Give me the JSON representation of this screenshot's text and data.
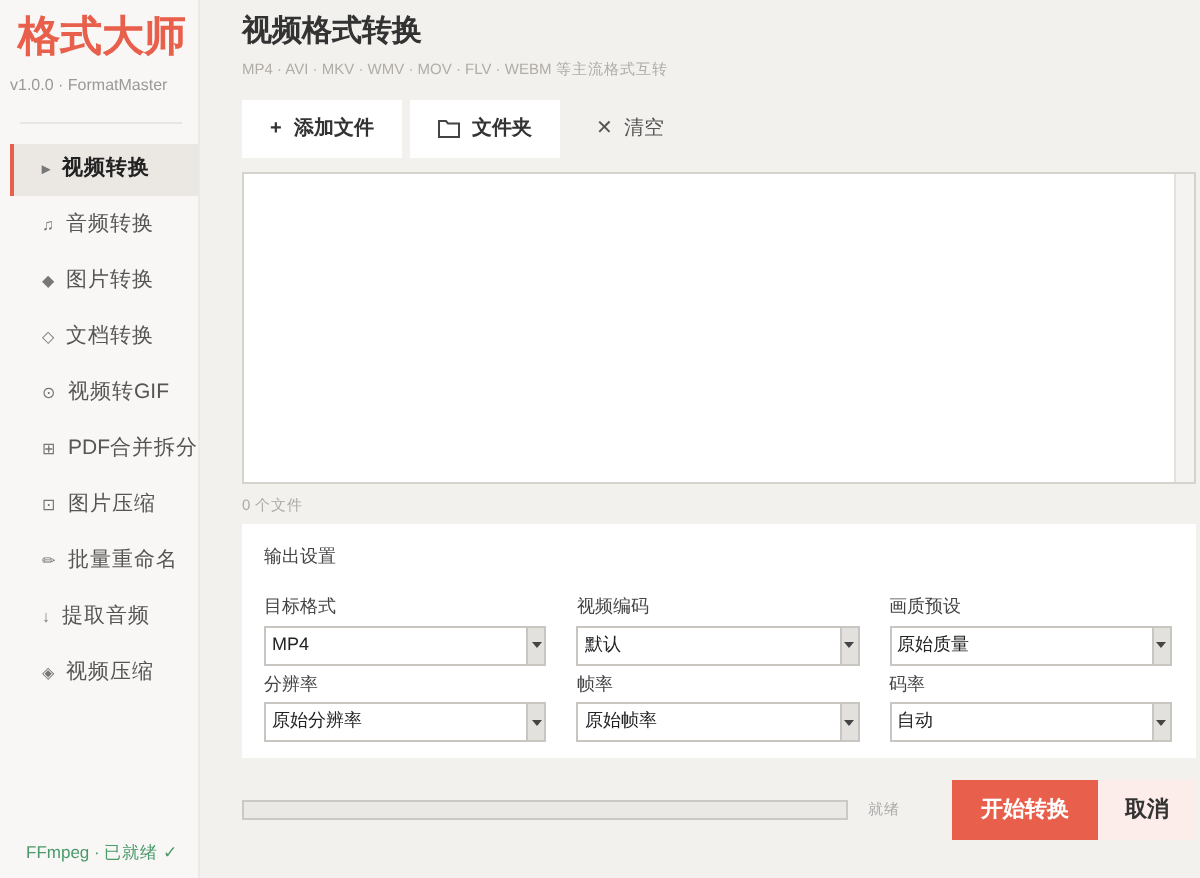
{
  "sidebar": {
    "logo": "格式大师",
    "version": "v1.0.0 · FormatMaster",
    "items": [
      {
        "icon": "▸",
        "label": "视频转换",
        "selected": true
      },
      {
        "icon": "♫",
        "label": "音频转换",
        "selected": false
      },
      {
        "icon": "◆",
        "label": "图片转换",
        "selected": false
      },
      {
        "icon": "◇",
        "label": "文档转换",
        "selected": false
      },
      {
        "icon": "⊙",
        "label": "视频转GIF",
        "selected": false
      },
      {
        "icon": "⊞",
        "label": "PDF合并拆分",
        "selected": false
      },
      {
        "icon": "⊡",
        "label": "图片压缩",
        "selected": false
      },
      {
        "icon": "✏",
        "label": "批量重命名",
        "selected": false
      },
      {
        "icon": "↓",
        "label": "提取音频",
        "selected": false
      },
      {
        "icon": "◈",
        "label": "视频压缩",
        "selected": false
      }
    ],
    "status": "FFmpeg · 已就绪 ✓"
  },
  "header": {
    "title": "视频格式转换",
    "subtitle": "MP4 · AVI · MKV · WMV · MOV · FLV · WEBM 等主流格式互转"
  },
  "toolbar": [
    {
      "kind": "add",
      "icon": "+",
      "label": "添加文件"
    },
    {
      "kind": "folder",
      "label": "文件夹"
    },
    {
      "kind": "clear",
      "icon": "✕",
      "label": "清空"
    }
  ],
  "file_count": "0 个文件",
  "settings": {
    "title": "输出设置",
    "fields": [
      {
        "label": "目标格式",
        "value": "MP4"
      },
      {
        "label": "视频编码",
        "value": "默认"
      },
      {
        "label": "画质预设",
        "value": "原始质量"
      },
      {
        "label": "分辨率",
        "value": "原始分辨率"
      },
      {
        "label": "帧率",
        "value": "原始帧率"
      },
      {
        "label": "码率",
        "value": "自动"
      }
    ]
  },
  "progress": {
    "level": 0,
    "status": "就绪"
  },
  "buttons": [
    {
      "kind": "primary",
      "label": "开始转换"
    },
    {
      "kind": "secondary",
      "label": "取消"
    }
  ]
}
